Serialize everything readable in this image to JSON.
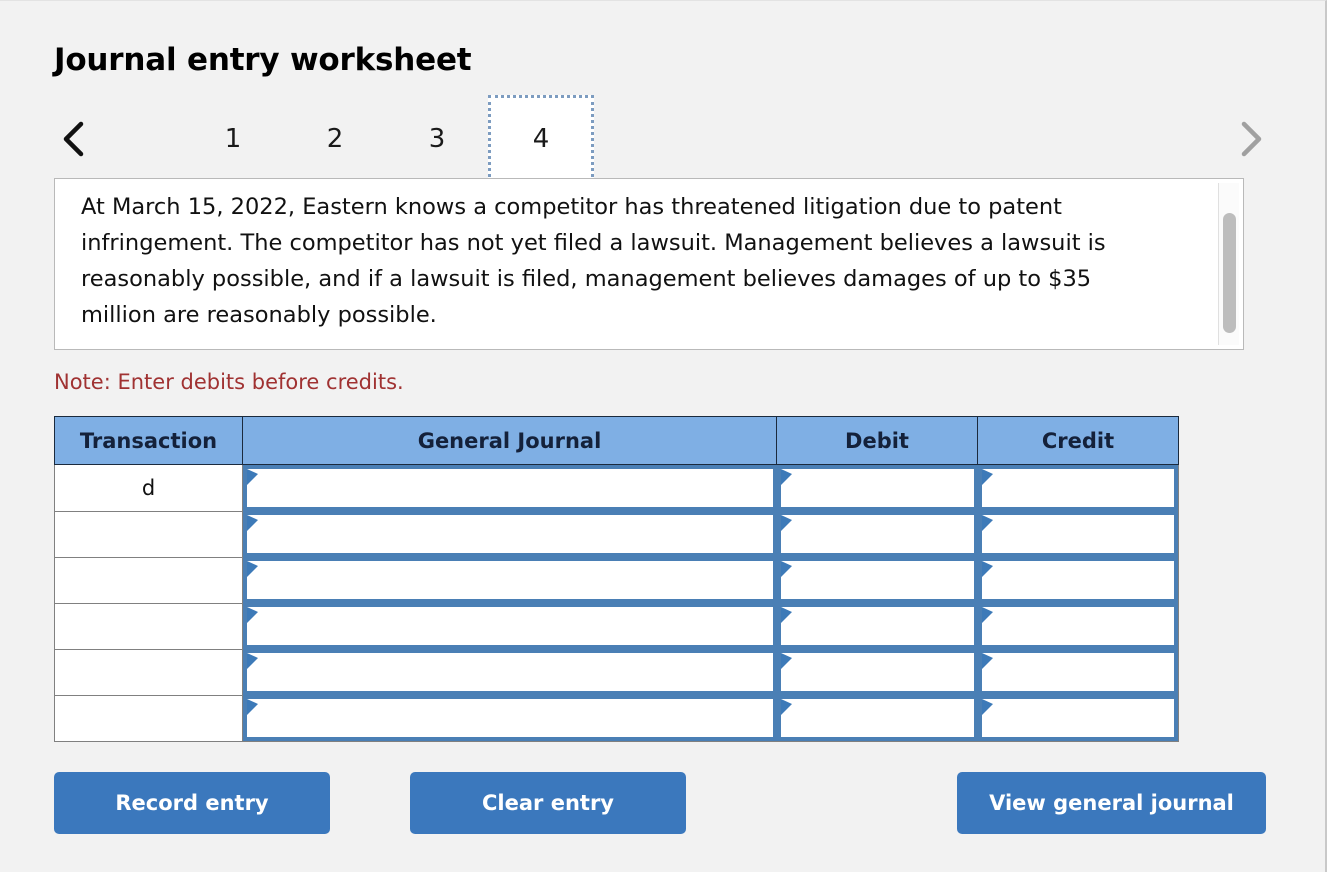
{
  "page": {
    "title": "Journal entry worksheet",
    "background_color": "#f2f2f2"
  },
  "navigation": {
    "prev_icon": "chevron-left-icon",
    "next_icon": "chevron-right-icon",
    "prev_enabled_color": "#000000",
    "next_enabled_color": "#a0a0a0",
    "tabs": [
      {
        "label": "1",
        "selected": false
      },
      {
        "label": "2",
        "selected": false
      },
      {
        "label": "3",
        "selected": false
      },
      {
        "label": "4",
        "selected": true
      }
    ],
    "selected_tab": "4"
  },
  "scenario": {
    "text": "At March 15, 2022, Eastern knows a competitor has threatened litigation due to patent infringement. The competitor has not yet filed a lawsuit. Management believes a lawsuit is reasonably possible, and if a lawsuit is filed, management believes damages of up to $35 million are reasonably possible.",
    "has_scrollbar": true
  },
  "note": {
    "text": "Note: Enter debits before credits.",
    "color": "#a03232"
  },
  "journal": {
    "header_color": "#7fafe4",
    "columns": [
      {
        "key": "transaction",
        "label": "Transaction"
      },
      {
        "key": "general_journal",
        "label": "General Journal"
      },
      {
        "key": "debit",
        "label": "Debit"
      },
      {
        "key": "credit",
        "label": "Credit"
      }
    ],
    "rows": [
      {
        "transaction": "d",
        "general_journal": "",
        "debit": "",
        "credit": ""
      },
      {
        "transaction": "",
        "general_journal": "",
        "debit": "",
        "credit": ""
      },
      {
        "transaction": "",
        "general_journal": "",
        "debit": "",
        "credit": ""
      },
      {
        "transaction": "",
        "general_journal": "",
        "debit": "",
        "credit": ""
      },
      {
        "transaction": "",
        "general_journal": "",
        "debit": "",
        "credit": ""
      },
      {
        "transaction": "",
        "general_journal": "",
        "debit": "",
        "credit": ""
      }
    ]
  },
  "buttons": {
    "record": "Record entry",
    "clear": "Clear entry",
    "view": "View general journal",
    "color": "#3b78bd"
  }
}
